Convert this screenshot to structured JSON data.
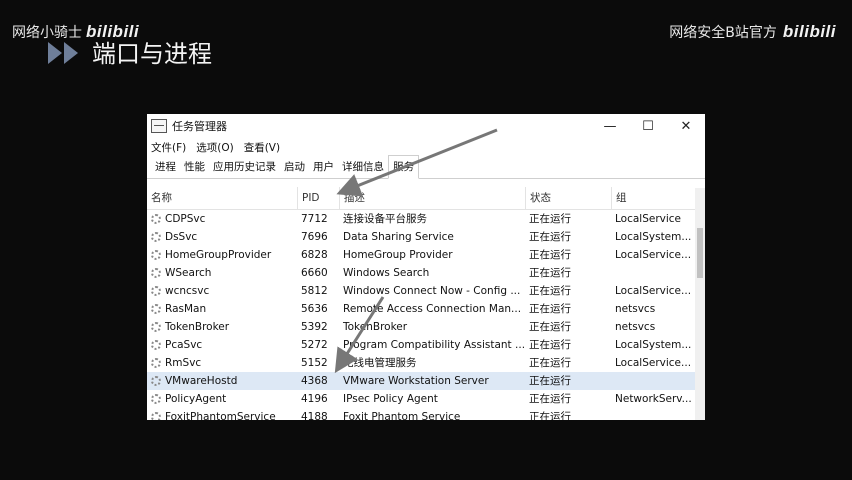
{
  "watermark_left": {
    "text": "网络小骑士",
    "logo": "bilibili"
  },
  "watermark_right": {
    "text": "网络安全B站官方",
    "logo": "bilibili"
  },
  "slide": {
    "title": "端口与进程"
  },
  "window": {
    "title": "任务管理器",
    "controls": {
      "minimize": "—",
      "maximize": "☐",
      "close": "✕"
    },
    "menu": [
      "文件(F)",
      "选项(O)",
      "查看(V)"
    ],
    "tabs": [
      "进程",
      "性能",
      "应用历史记录",
      "启动",
      "用户",
      "详细信息",
      "服务"
    ],
    "active_tab": "服务",
    "columns": {
      "name": "名称",
      "pid": "PID",
      "desc": "描述",
      "status": "状态",
      "group": "组"
    },
    "rows": [
      {
        "name": "CDPSvc",
        "pid": "7712",
        "desc": "连接设备平台服务",
        "status": "正在运行",
        "group": "LocalService"
      },
      {
        "name": "DsSvc",
        "pid": "7696",
        "desc": "Data Sharing Service",
        "status": "正在运行",
        "group": "LocalSystem..."
      },
      {
        "name": "HomeGroupProvider",
        "pid": "6828",
        "desc": "HomeGroup Provider",
        "status": "正在运行",
        "group": "LocalService..."
      },
      {
        "name": "WSearch",
        "pid": "6660",
        "desc": "Windows Search",
        "status": "正在运行",
        "group": ""
      },
      {
        "name": "wcncsvc",
        "pid": "5812",
        "desc": "Windows Connect Now - Config ...",
        "status": "正在运行",
        "group": "LocalService..."
      },
      {
        "name": "RasMan",
        "pid": "5636",
        "desc": "Remote Access Connection Man...",
        "status": "正在运行",
        "group": "netsvcs"
      },
      {
        "name": "TokenBroker",
        "pid": "5392",
        "desc": "TokenBroker",
        "status": "正在运行",
        "group": "netsvcs"
      },
      {
        "name": "PcaSvc",
        "pid": "5272",
        "desc": "Program Compatibility Assistant ...",
        "status": "正在运行",
        "group": "LocalSystem..."
      },
      {
        "name": "RmSvc",
        "pid": "5152",
        "desc": "无线电管理服务",
        "status": "正在运行",
        "group": "LocalService..."
      },
      {
        "name": "VMwareHostd",
        "pid": "4368",
        "desc": "VMware Workstation Server",
        "status": "正在运行",
        "group": ""
      },
      {
        "name": "PolicyAgent",
        "pid": "4196",
        "desc": "IPsec Policy Agent",
        "status": "正在运行",
        "group": "NetworkServ..."
      },
      {
        "name": "FoxitPhantomService",
        "pid": "4188",
        "desc": "Foxit Phantom Service",
        "status": "正在运行",
        "group": ""
      }
    ]
  }
}
